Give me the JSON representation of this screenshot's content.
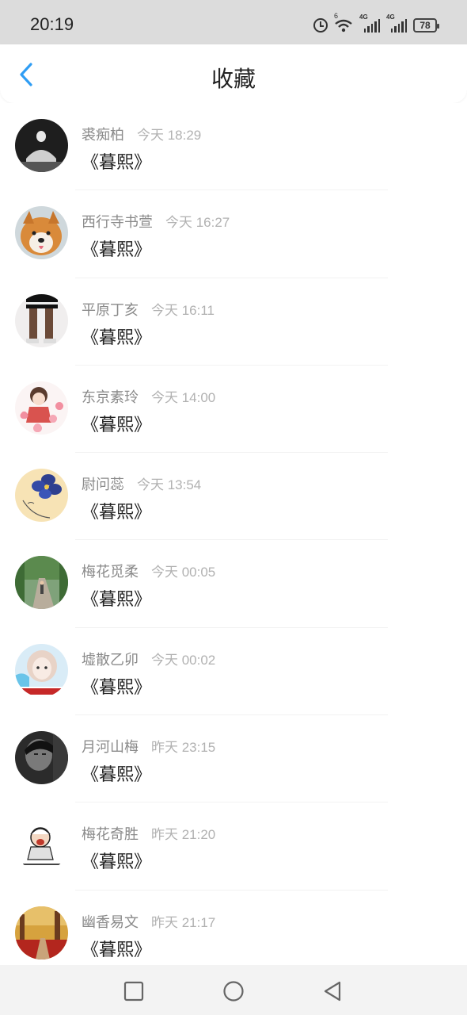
{
  "status_bar": {
    "time": "20:19",
    "wifi_label": "6",
    "signal1_label": "4G",
    "signal2_label": "4G",
    "battery": "78"
  },
  "header": {
    "title": "收藏",
    "back_icon": "chevron-left-icon",
    "accent_color": "#2f9df4"
  },
  "items": [
    {
      "name": "裘痴柏",
      "time": "今天 18:29",
      "title": "《暮熙》",
      "avatar": "avatar-dark-pose"
    },
    {
      "name": "西行寺书萱",
      "time": "今天 16:27",
      "title": "《暮熙》",
      "avatar": "avatar-shiba-dog"
    },
    {
      "name": "平原丁亥",
      "time": "今天 16:11",
      "title": "《暮熙》",
      "avatar": "avatar-legs"
    },
    {
      "name": "东京素玲",
      "time": "今天 14:00",
      "title": "《暮熙》",
      "avatar": "avatar-anime-hearts"
    },
    {
      "name": "尉问蕊",
      "time": "今天 13:54",
      "title": "《暮熙》",
      "avatar": "avatar-blue-flower"
    },
    {
      "name": "梅花觅柔",
      "time": "今天 00:05",
      "title": "《暮熙》",
      "avatar": "avatar-road-trees"
    },
    {
      "name": "墟散乙卯",
      "time": "今天 00:02",
      "title": "《暮熙》",
      "avatar": "avatar-girl-photo"
    },
    {
      "name": "月河山梅",
      "time": "昨天 23:15",
      "title": "《暮熙》",
      "avatar": "avatar-bw-portrait"
    },
    {
      "name": "梅花奇胜",
      "time": "昨天 21:20",
      "title": "《暮熙》",
      "avatar": "avatar-cartoon-meme"
    },
    {
      "name": "幽香易文",
      "time": "昨天 21:17",
      "title": "《暮熙》",
      "avatar": "avatar-autumn-path"
    }
  ],
  "nav": {
    "recent_icon": "square-icon",
    "home_icon": "circle-icon",
    "back_icon": "triangle-back-icon"
  }
}
